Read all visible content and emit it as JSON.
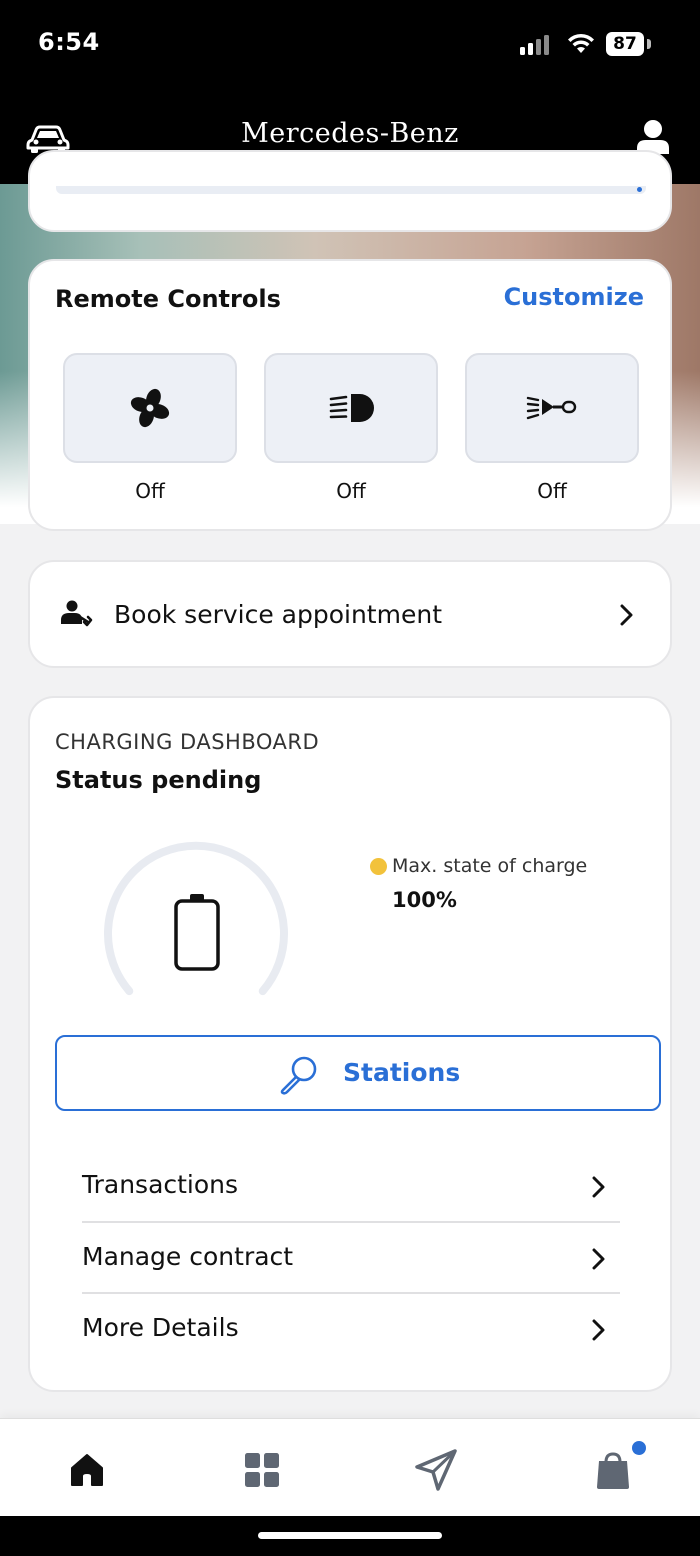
{
  "status_bar": {
    "time": "6:54",
    "battery": "87"
  },
  "header": {
    "brand": "Mercedes-Benz"
  },
  "remote_controls": {
    "title": "Remote Controls",
    "customize_label": "Customize",
    "controls": [
      {
        "icon": "fan-icon",
        "state": "Off"
      },
      {
        "icon": "headlight-icon",
        "state": "Off"
      },
      {
        "icon": "horn-icon",
        "state": "Off"
      }
    ]
  },
  "service": {
    "label": "Book service appointment",
    "icon": "service-person-icon"
  },
  "charging": {
    "kicker": "CHARGING DASHBOARD",
    "status": "Status pending",
    "max_soc_label": "Max. state of charge",
    "max_soc_value": "100%",
    "stations_label": "Stations",
    "menu": [
      {
        "label": "Transactions"
      },
      {
        "label": "Manage contract"
      },
      {
        "label": "More Details"
      }
    ]
  },
  "tabs": [
    {
      "icon": "home-icon",
      "active": true
    },
    {
      "icon": "grid-icon",
      "active": false
    },
    {
      "icon": "send-icon",
      "active": false
    },
    {
      "icon": "shopping-bag-icon",
      "active": false
    }
  ],
  "colors": {
    "accent": "#2a6fd6",
    "soc_dot": "#f2c23b",
    "header_bg": "#000000"
  }
}
